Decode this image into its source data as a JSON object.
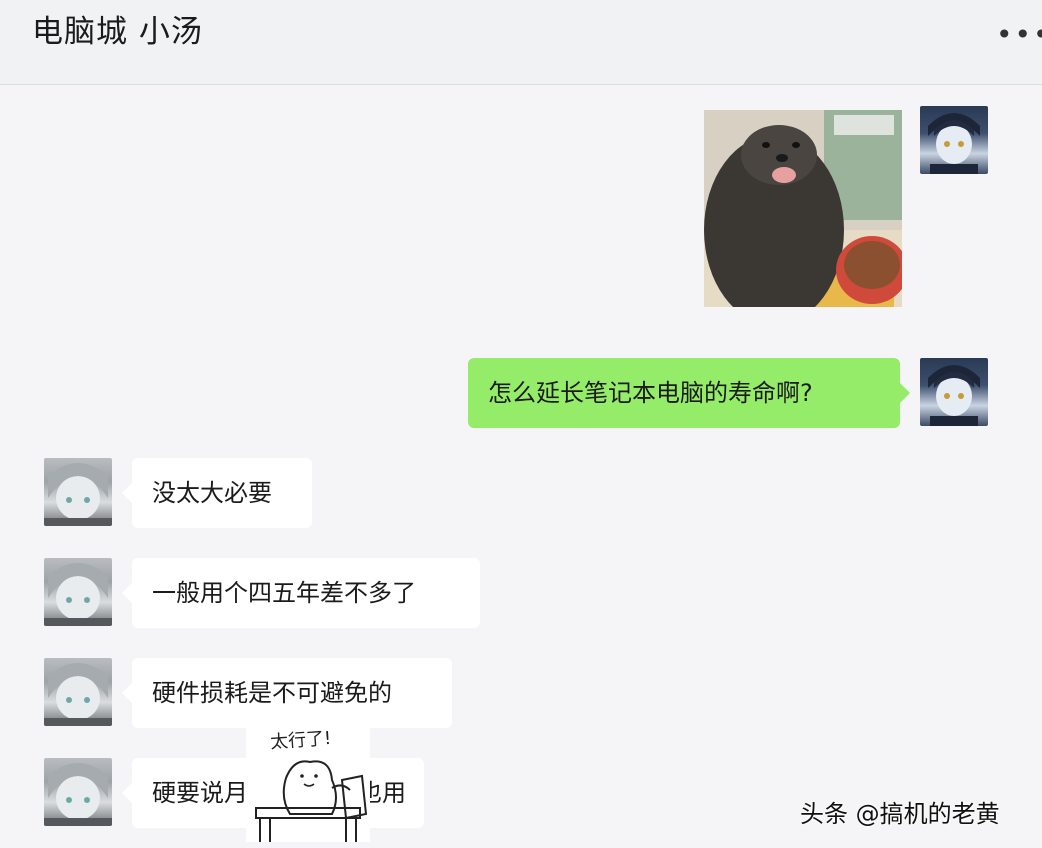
{
  "chat": {
    "title": "电脑城 小汤",
    "more_icon": "more-dots-icon"
  },
  "messages": [
    {
      "sender": "me",
      "type": "image",
      "content": "otter-photo"
    },
    {
      "sender": "me",
      "type": "text",
      "text": "怎么延长笔记本电脑的寿命啊?"
    },
    {
      "sender": "other",
      "type": "text",
      "text": "没太大必要"
    },
    {
      "sender": "other",
      "type": "text",
      "text": "一般用个四五年差不多了"
    },
    {
      "sender": "other",
      "type": "text",
      "text": "硬件损耗是不可避免的"
    },
    {
      "sender": "other",
      "type": "text",
      "text": "硬要说月",
      "text_after_sticker": "也用"
    }
  ],
  "sticker": {
    "text": "太行了!"
  },
  "watermark": "头条 @搞机的老黄",
  "colors": {
    "sent_bubble": "#95ec69",
    "received_bubble": "#ffffff",
    "background": "#f5f5f7"
  }
}
